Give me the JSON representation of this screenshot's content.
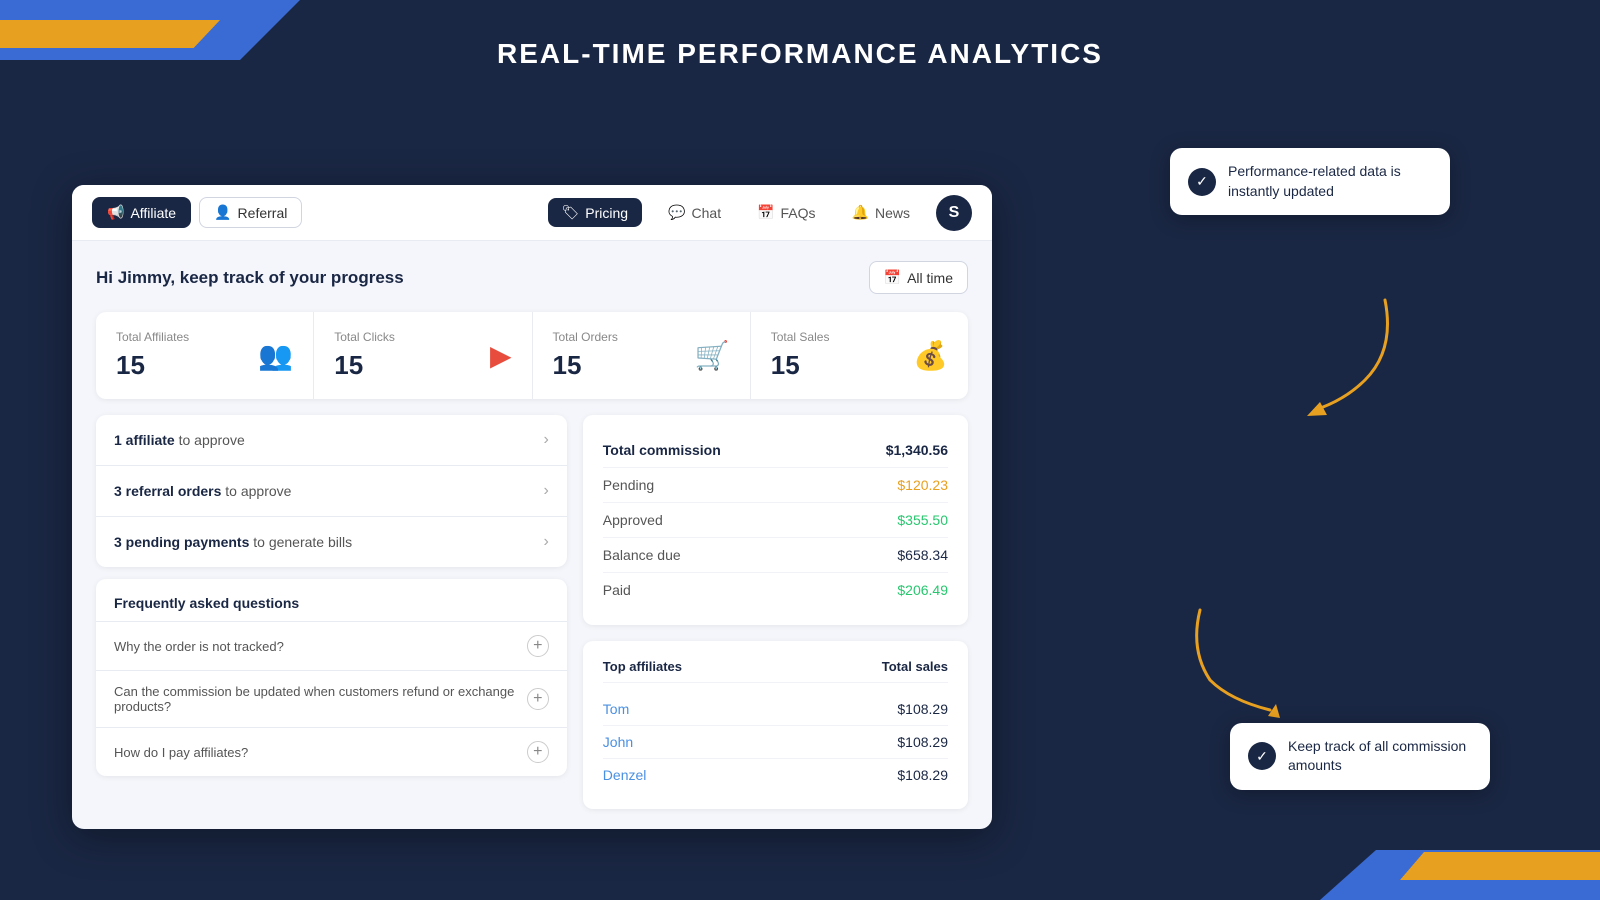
{
  "page": {
    "title": "REAL-TIME PERFORMANCE ANALYTICS"
  },
  "decorative": {
    "corner_tl_color": "#3a6bd4",
    "corner_orange_color": "#e8a020"
  },
  "tooltip_top": {
    "text": "Performance-related data is instantly updated",
    "check_symbol": "✓"
  },
  "tooltip_bottom": {
    "text": "Keep track of all commission amounts",
    "check_symbol": "✓"
  },
  "nav": {
    "affiliate_label": "Affiliate",
    "referral_label": "Referral",
    "pricing_label": "Pricing",
    "chat_label": "Chat",
    "faqs_label": "FAQs",
    "news_label": "News",
    "avatar_letter": "S"
  },
  "content": {
    "greeting": "Hi Jimmy, keep track of your progress",
    "all_time_label": "All time"
  },
  "stats": [
    {
      "label": "Total Affiliates",
      "value": "15",
      "icon": "👥",
      "icon_color": "#9b59b6"
    },
    {
      "label": "Total Clicks",
      "value": "15",
      "icon": "🖱",
      "icon_color": "#e74c3c"
    },
    {
      "label": "Total Orders",
      "value": "15",
      "icon": "🛒",
      "icon_color": "#3a9bd4"
    },
    {
      "label": "Total Sales",
      "value": "15",
      "icon": "💰",
      "icon_color": "#28c76f"
    }
  ],
  "actions": [
    {
      "prefix": "1 affiliate",
      "suffix": " to approve"
    },
    {
      "prefix": "3 referral orders",
      "suffix": " to approve"
    },
    {
      "prefix": "3 pending payments",
      "suffix": " to generate bills"
    }
  ],
  "faq": {
    "title": "Frequently asked questions",
    "items": [
      "Why the order is not tracked?",
      "Can the commission be updated when customers refund or exchange products?",
      "How do I pay affiliates?"
    ]
  },
  "commission": {
    "rows": [
      {
        "label": "Total commission",
        "value": "$1,340.56",
        "label_bold": true,
        "value_style": "bold"
      },
      {
        "label": "Pending",
        "value": "$120.23",
        "value_style": "orange"
      },
      {
        "label": "Approved",
        "value": "$355.50",
        "value_style": "green"
      },
      {
        "label": "Balance due",
        "value": "$658.34",
        "value_style": "normal"
      },
      {
        "label": "Paid",
        "value": "$206.49",
        "value_style": "green"
      }
    ]
  },
  "top_affiliates": {
    "col1": "Top affiliates",
    "col2": "Total sales",
    "rows": [
      {
        "name": "Tom",
        "sales": "$108.29"
      },
      {
        "name": "John",
        "sales": "$108.29"
      },
      {
        "name": "Denzel",
        "sales": "$108.29"
      }
    ]
  }
}
